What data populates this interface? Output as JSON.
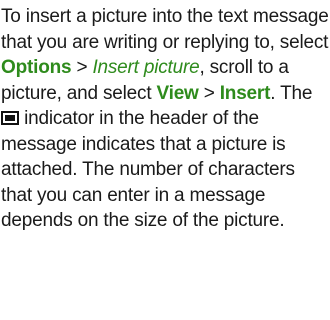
{
  "paragraph": {
    "t1": "To insert a picture into the text message that you are writing or replying to, select ",
    "options": "Options",
    "t2": " > ",
    "insert_picture": "Insert picture",
    "t3": ", scroll to a picture, and select ",
    "view": "View",
    "t4": " > ",
    "insert": "Insert",
    "t5": ". The ",
    "indicator_icon": "picture-attached-icon",
    "t6": " indicator in the header of the message indicates that a picture is attached. The number of characters that you can enter in a message depends on the size of the picture."
  },
  "colors": {
    "text": "#1a1a1a",
    "ui_term": "#2e8b1c"
  }
}
